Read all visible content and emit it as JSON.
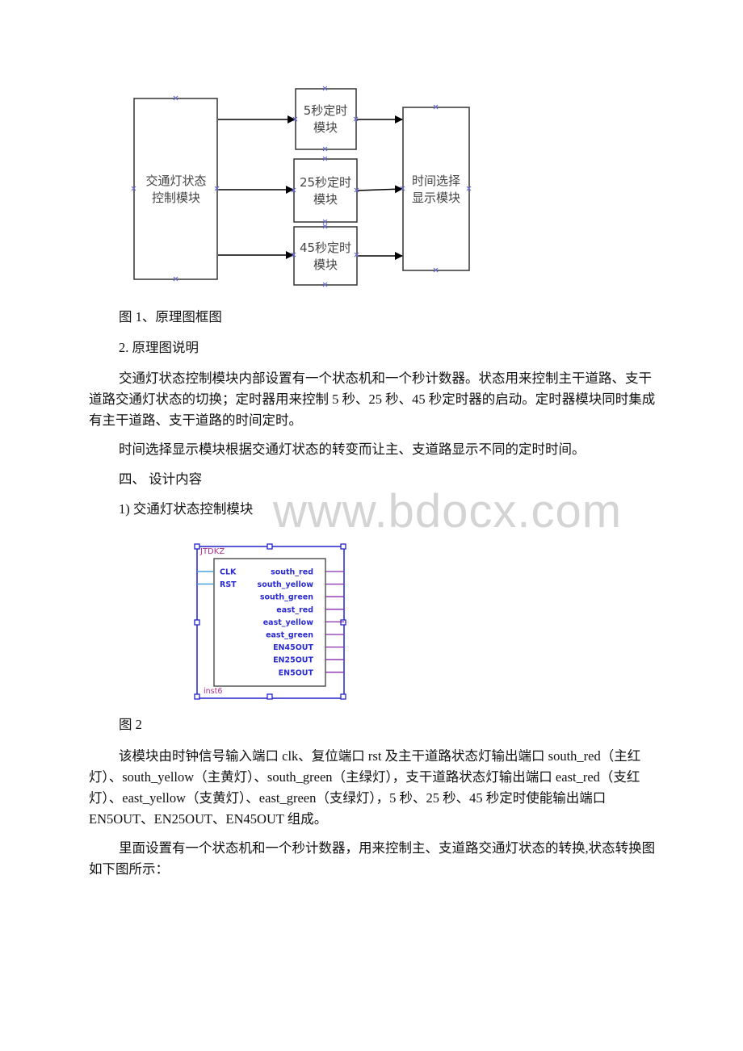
{
  "figure1": {
    "blocks": {
      "control": [
        "交通灯状态",
        "控制模块"
      ],
      "timer5": [
        "5秒定时",
        "模块"
      ],
      "timer25": [
        "25秒定时",
        "模块"
      ],
      "timer45": [
        "45秒定时",
        "模块"
      ],
      "display": [
        "时间选择",
        "显示模块"
      ]
    },
    "caption": "图 1、原理图框图"
  },
  "section_2_heading": "2. 原理图说明",
  "para1": "交通灯状态控制模块内部设置有一个状态机和一个秒计数器。状态用来控制主干道路、支干道路交通灯状态的切换；定时器用来控制 5 秒、25 秒、45 秒定时器的启动。定时器模块同时集成有主干道路、支干道路的时间定时。",
  "para2": "时间选择显示模块根据交通灯状态的转变而让主、支道路显示不同的定时时间。",
  "section_4_heading": "四、 设计内容",
  "subsection_1_heading": "1) 交通灯状态控制模块",
  "watermark": "www.bdocx.com",
  "figure2": {
    "module_name": "JTDKZ",
    "instance_name": "inst6",
    "inputs": [
      "CLK",
      "RST"
    ],
    "outputs": [
      "south_red",
      "south_yellow",
      "south_green",
      "east_red",
      "east_yellow",
      "east_green",
      "EN45OUT",
      "EN25OUT",
      "EN5OUT"
    ],
    "caption": "图 2",
    "colors": {
      "port_text": "#2b2bd6",
      "frame": "#2222cc",
      "output_wire": "#8a2bb0",
      "input_wire": "#2a8fd6",
      "label": "#b03090"
    }
  },
  "para3": "该模块由时钟信号输入端口 clk、复位端口 rst 及主干道路状态灯输出端口 south_red（主红灯）、south_yellow（主黄灯）、south_green（主绿灯），支干道路状态灯输出端口 east_red（支红灯）、east_yellow（支黄灯）、east_green（支绿灯），5 秒、25 秒、45 秒定时使能输出端口 EN5OUT、EN25OUT、EN45OUT 组成。",
  "para4": "里面设置有一个状态机和一个秒计数器，用来控制主、支道路交通灯状态的转换,状态转换图如下图所示："
}
